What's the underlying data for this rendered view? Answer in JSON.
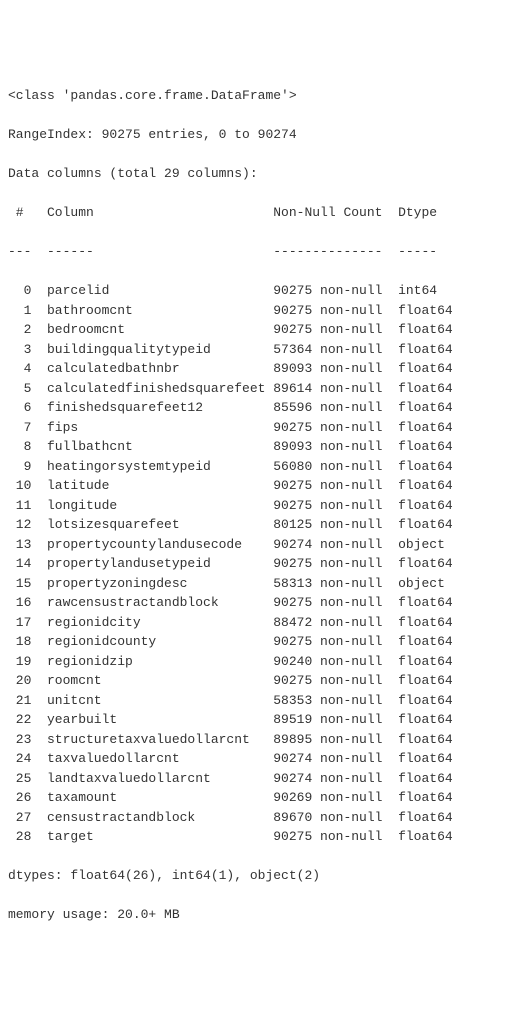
{
  "header": {
    "class_line": "<class 'pandas.core.frame.DataFrame'>",
    "range_index": "RangeIndex: 90275 entries, 0 to 90274",
    "data_cols": "Data columns (total 29 columns):",
    "col_hdr_idx": " # ",
    "col_hdr_col": "Column",
    "col_hdr_nn": "Non-Null Count",
    "col_hdr_dt": "Dtype",
    "sep_idx": "---",
    "sep_col": "------",
    "sep_nn": "--------------",
    "sep_dt": "-----"
  },
  "columns": [
    {
      "idx": "0",
      "name": "parcelid",
      "nn": "90275 non-null",
      "dtype": "int64"
    },
    {
      "idx": "1",
      "name": "bathroomcnt",
      "nn": "90275 non-null",
      "dtype": "float64"
    },
    {
      "idx": "2",
      "name": "bedroomcnt",
      "nn": "90275 non-null",
      "dtype": "float64"
    },
    {
      "idx": "3",
      "name": "buildingqualitytypeid",
      "nn": "57364 non-null",
      "dtype": "float64"
    },
    {
      "idx": "4",
      "name": "calculatedbathnbr",
      "nn": "89093 non-null",
      "dtype": "float64"
    },
    {
      "idx": "5",
      "name": "calculatedfinishedsquarefeet",
      "nn": "89614 non-null",
      "dtype": "float64"
    },
    {
      "idx": "6",
      "name": "finishedsquarefeet12",
      "nn": "85596 non-null",
      "dtype": "float64"
    },
    {
      "idx": "7",
      "name": "fips",
      "nn": "90275 non-null",
      "dtype": "float64"
    },
    {
      "idx": "8",
      "name": "fullbathcnt",
      "nn": "89093 non-null",
      "dtype": "float64"
    },
    {
      "idx": "9",
      "name": "heatingorsystemtypeid",
      "nn": "56080 non-null",
      "dtype": "float64"
    },
    {
      "idx": "10",
      "name": "latitude",
      "nn": "90275 non-null",
      "dtype": "float64"
    },
    {
      "idx": "11",
      "name": "longitude",
      "nn": "90275 non-null",
      "dtype": "float64"
    },
    {
      "idx": "12",
      "name": "lotsizesquarefeet",
      "nn": "80125 non-null",
      "dtype": "float64"
    },
    {
      "idx": "13",
      "name": "propertycountylandusecode",
      "nn": "90274 non-null",
      "dtype": "object"
    },
    {
      "idx": "14",
      "name": "propertylandusetypeid",
      "nn": "90275 non-null",
      "dtype": "float64"
    },
    {
      "idx": "15",
      "name": "propertyzoningdesc",
      "nn": "58313 non-null",
      "dtype": "object"
    },
    {
      "idx": "16",
      "name": "rawcensustractandblock",
      "nn": "90275 non-null",
      "dtype": "float64"
    },
    {
      "idx": "17",
      "name": "regionidcity",
      "nn": "88472 non-null",
      "dtype": "float64"
    },
    {
      "idx": "18",
      "name": "regionidcounty",
      "nn": "90275 non-null",
      "dtype": "float64"
    },
    {
      "idx": "19",
      "name": "regionidzip",
      "nn": "90240 non-null",
      "dtype": "float64"
    },
    {
      "idx": "20",
      "name": "roomcnt",
      "nn": "90275 non-null",
      "dtype": "float64"
    },
    {
      "idx": "21",
      "name": "unitcnt",
      "nn": "58353 non-null",
      "dtype": "float64"
    },
    {
      "idx": "22",
      "name": "yearbuilt",
      "nn": "89519 non-null",
      "dtype": "float64"
    },
    {
      "idx": "23",
      "name": "structuretaxvaluedollarcnt",
      "nn": "89895 non-null",
      "dtype": "float64"
    },
    {
      "idx": "24",
      "name": "taxvaluedollarcnt",
      "nn": "90274 non-null",
      "dtype": "float64"
    },
    {
      "idx": "25",
      "name": "landtaxvaluedollarcnt",
      "nn": "90274 non-null",
      "dtype": "float64"
    },
    {
      "idx": "26",
      "name": "taxamount",
      "nn": "90269 non-null",
      "dtype": "float64"
    },
    {
      "idx": "27",
      "name": "censustractandblock",
      "nn": "89670 non-null",
      "dtype": "float64"
    },
    {
      "idx": "28",
      "name": "target",
      "nn": "90275 non-null",
      "dtype": "float64"
    }
  ],
  "footer": {
    "dtypes": "dtypes: float64(26), int64(1), object(2)",
    "memory": "memory usage: 20.0+ MB"
  }
}
